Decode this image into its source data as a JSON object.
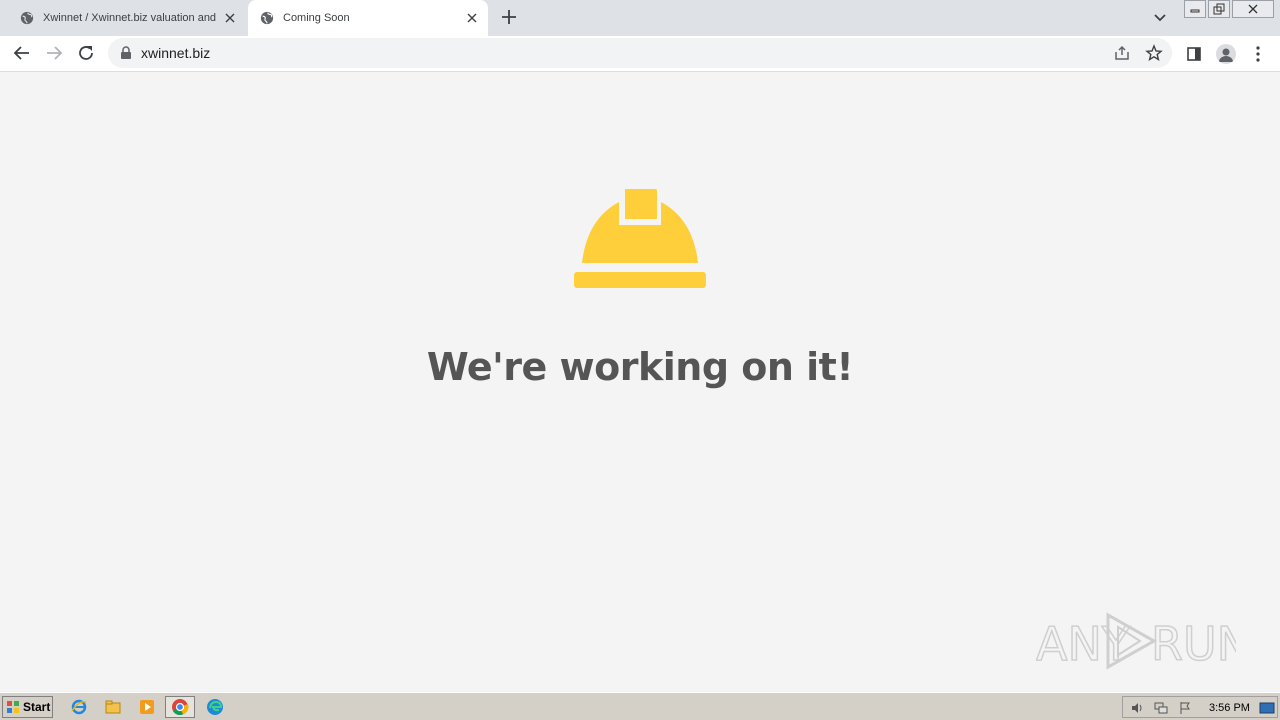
{
  "browser": {
    "tabs": [
      {
        "title": "Xwinnet / Xwinnet.biz valuation and",
        "active": false
      },
      {
        "title": "Coming Soon",
        "active": true
      }
    ],
    "address": "xwinnet.biz"
  },
  "page": {
    "heading": "We're working on it!",
    "helmet_color": "#ffce3b",
    "heading_color": "#555555",
    "background_color": "#f4f4f4"
  },
  "watermark": {
    "text_left": "ANY",
    "text_right": "RUN"
  },
  "taskbar": {
    "start_label": "Start",
    "clock": "3:56 PM",
    "apps": [
      "internet-explorer-icon",
      "file-explorer-icon",
      "media-player-icon",
      "chrome-icon",
      "edge-icon"
    ]
  }
}
